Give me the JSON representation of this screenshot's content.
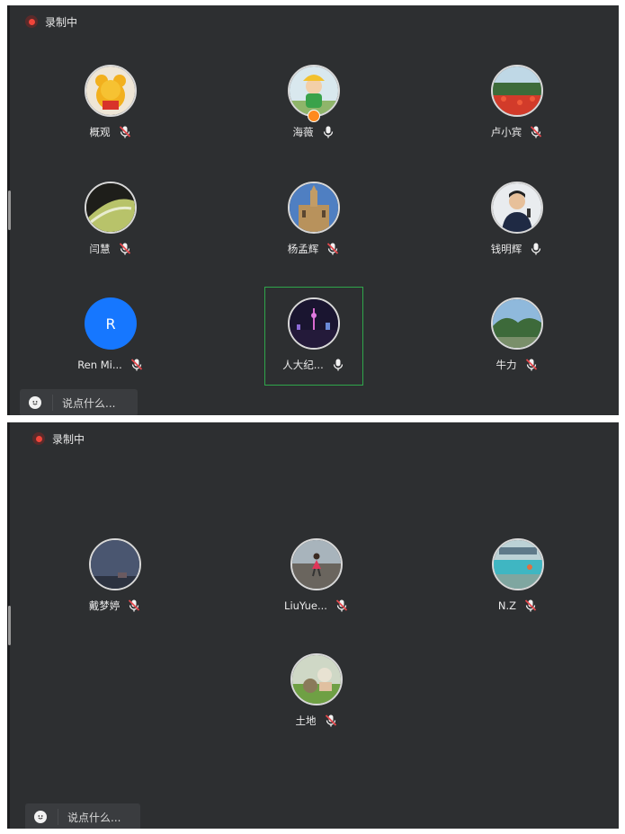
{
  "recording_label": "录制中",
  "chat_placeholder": "说点什么...",
  "screen1": {
    "participants": [
      {
        "name": "概观",
        "mic": "muted",
        "avatar": "winnie-pooh-toy"
      },
      {
        "name": "海薇",
        "mic": "on",
        "avatar": "child-in-hat",
        "host": true
      },
      {
        "name": "卢小宾",
        "mic": "muted",
        "avatar": "red-tulip-field"
      },
      {
        "name": "闫慧",
        "mic": "muted",
        "avatar": "leaf-closeup"
      },
      {
        "name": "杨孟辉",
        "mic": "muted",
        "avatar": "tower-building"
      },
      {
        "name": "钱明辉",
        "mic": "on",
        "avatar": "man-with-microphone"
      },
      {
        "name": "Ren Mi...",
        "mic": "muted",
        "avatar": "letter",
        "letter": "R"
      },
      {
        "name": "人大纪...",
        "mic": "on",
        "avatar": "night-skyline",
        "active_speaker": true
      },
      {
        "name": "牛力",
        "mic": "muted",
        "avatar": "trees-sky"
      }
    ]
  },
  "screen2": {
    "participants": [
      {
        "name": "戴梦婷",
        "mic": "muted",
        "avatar": "night-sky"
      },
      {
        "name": "LiuYue...",
        "mic": "muted",
        "avatar": "girl-on-beach"
      },
      {
        "name": "N.Z",
        "mic": "muted",
        "avatar": "pool-scene"
      },
      {
        "name": "土地",
        "mic": "muted",
        "avatar": "pets-on-grass"
      }
    ]
  },
  "colors": {
    "background": "#2d2f31",
    "record_red": "#f0453a",
    "mic_muted_red": "#e5484d",
    "active_speaker_green": "#2fa64b",
    "letter_avatar_blue": "#1677ff",
    "host_badge_orange": "#ff8a1e"
  }
}
